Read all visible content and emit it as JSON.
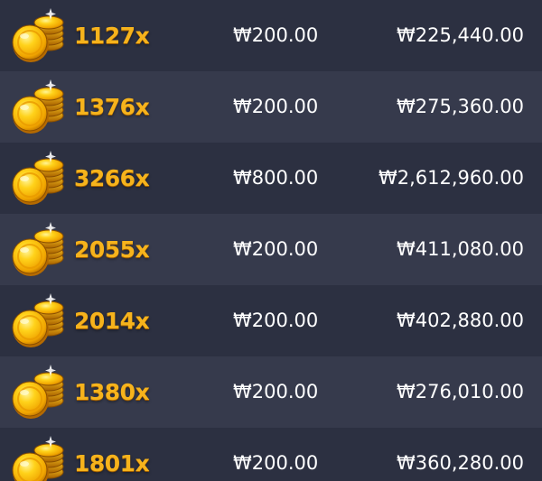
{
  "coin_icon": "gold-coins-icon",
  "colors": {
    "multiplier": "#f6b31c",
    "row_dark": "#2c3041",
    "row_light": "#363a4c",
    "text": "#ffffff"
  },
  "rows": [
    {
      "multiplier": "1127x",
      "bet": "₩200.00",
      "win": "₩225,440.00"
    },
    {
      "multiplier": "1376x",
      "bet": "₩200.00",
      "win": "₩275,360.00"
    },
    {
      "multiplier": "3266x",
      "bet": "₩800.00",
      "win": "₩2,612,960.00"
    },
    {
      "multiplier": "2055x",
      "bet": "₩200.00",
      "win": "₩411,080.00"
    },
    {
      "multiplier": "2014x",
      "bet": "₩200.00",
      "win": "₩402,880.00"
    },
    {
      "multiplier": "1380x",
      "bet": "₩200.00",
      "win": "₩276,010.00"
    },
    {
      "multiplier": "1801x",
      "bet": "₩200.00",
      "win": "₩360,280.00"
    }
  ]
}
